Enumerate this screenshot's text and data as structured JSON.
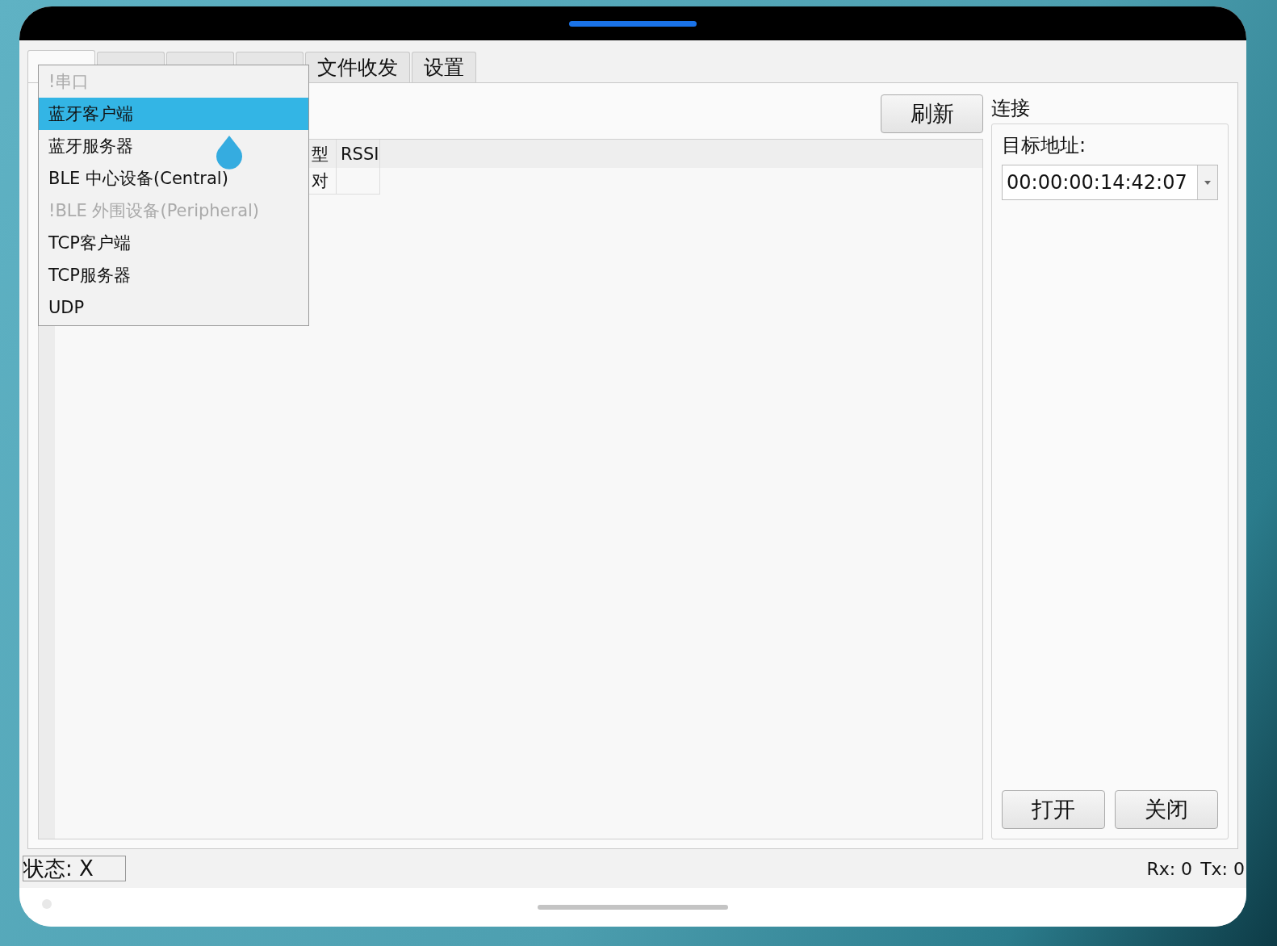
{
  "tabs": [
    {
      "selected": true
    },
    {
      "selected": false
    },
    {
      "selected": false
    },
    {
      "selected": false
    },
    {
      "label": "文件收发",
      "selected": false
    },
    {
      "label": "设置",
      "selected": false
    }
  ],
  "dropdown": {
    "items": [
      {
        "label": "!串口",
        "selected": false,
        "disabled": true
      },
      {
        "label": "蓝牙客户端",
        "selected": true,
        "disabled": false
      },
      {
        "label": "蓝牙服务器",
        "selected": false,
        "disabled": false
      },
      {
        "label": "BLE 中心设备(Central)",
        "selected": false,
        "disabled": false
      },
      {
        "label": "!BLE 外围设备(Peripheral)",
        "selected": false,
        "disabled": true
      },
      {
        "label": "TCP客户端",
        "selected": false,
        "disabled": false
      },
      {
        "label": "TCP服务器",
        "selected": false,
        "disabled": false
      },
      {
        "label": "UDP",
        "selected": false,
        "disabled": false
      }
    ]
  },
  "refresh_button": "刷新",
  "table": {
    "columns": [
      "型",
      "RSSI"
    ],
    "rows": [
      {
        "cells": [
          "对"
        ]
      }
    ]
  },
  "connection": {
    "title": "连接",
    "address_label": "目标地址:",
    "address_value": "00:00:00:14:42:07",
    "buttons": [
      "打开",
      "关闭"
    ]
  },
  "status_bar": {
    "status": "状态: X",
    "rx": "Rx: 0",
    "tx": "Tx: 0"
  }
}
